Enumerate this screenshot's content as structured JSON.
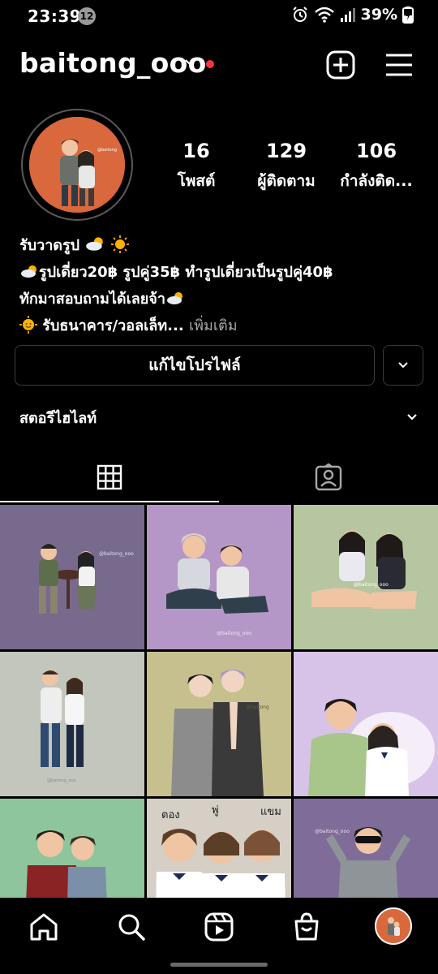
{
  "status_bar": {
    "time": "23:39",
    "notification_count": "12",
    "battery": "39%"
  },
  "header": {
    "username": "baitong_ooo"
  },
  "stats": [
    {
      "value": "16",
      "label": "โพสต์"
    },
    {
      "value": "129",
      "label": "ผู้ติดตาม"
    },
    {
      "value": "106",
      "label": "กำลังติด..."
    }
  ],
  "bio": {
    "line1": "รับวาดรูป",
    "line2": "รูปเดี่ยว20฿ รูปคู่35฿ ทำรูปเดี่ยวเป็นรูปคู่40฿",
    "line3": "ทักมาสอบถามได้เลยจ้า",
    "line4": "รับธนาคาร/วอลเล็ท...",
    "more": "เพิ่มเติม"
  },
  "buttons": {
    "edit_profile": "แก้ไขโปรไฟล์"
  },
  "highlights": {
    "label": "สตอรีไฮไลท์"
  },
  "tabs": [
    {
      "name": "grid",
      "icon": "grid-icon",
      "active": true
    },
    {
      "name": "tagged",
      "icon": "tagged-person-icon",
      "active": false
    }
  ],
  "posts": [
    {
      "bg": "#776a8c"
    },
    {
      "bg": "#b497c7"
    },
    {
      "bg": "#b5c6a0"
    },
    {
      "bg": "#c3c6bd"
    },
    {
      "bg": "#c6c08f"
    },
    {
      "bg": "#d7c3e8"
    },
    {
      "bg": "#8ec59d"
    },
    {
      "bg": "#d5cfc5"
    },
    {
      "bg": "#7f6c99"
    }
  ],
  "tile_labels": {
    "tile7_left": "ตอง",
    "tile7_mid": "พู่",
    "tile7_right": "แขม"
  },
  "colors": {
    "accent_dot": "#ff3040",
    "avatar_bg": "#d9683d"
  },
  "bottom_nav": [
    "home-icon",
    "search-icon",
    "reels-icon",
    "shop-icon",
    "profile-avatar"
  ]
}
